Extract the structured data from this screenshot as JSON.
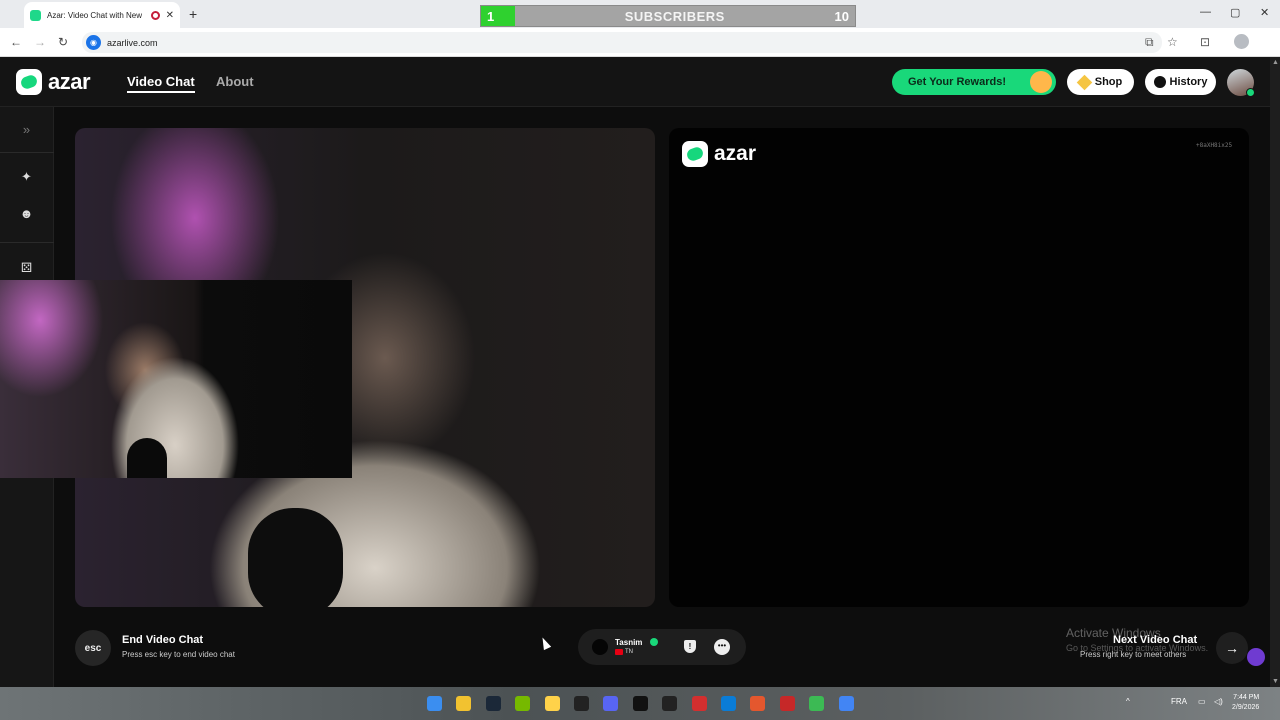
{
  "browser": {
    "tab_title": "Azar: Video Chat with New",
    "close_tab": "✕",
    "new_tab": "+",
    "url": "azarlive.com",
    "window_controls": [
      "—",
      "▢",
      "✕"
    ],
    "nav": [
      "←",
      "→",
      "↻"
    ],
    "right_icons": [
      "cast-icon",
      "star-icon",
      "extensions-icon"
    ]
  },
  "overlay": {
    "left_count": "1",
    "label": "SUBSCRIBERS",
    "right_count": "10"
  },
  "header": {
    "brand": "azar",
    "nav": [
      {
        "label": "Video Chat",
        "active": true
      },
      {
        "label": "About",
        "active": false
      }
    ],
    "rewards_label": "Get Your Rewards!",
    "shop_label": "Shop",
    "history_label": "History"
  },
  "rail": {
    "icons": [
      "double-chevron-right-icon",
      "magic-wand-icon",
      "smiley-icon",
      "dice-icon"
    ],
    "expand_glyph": "»"
  },
  "remote": {
    "brand": "azar",
    "session_id": "+8aXH8ix25"
  },
  "controls": {
    "esc_label": "esc",
    "end_title": "End Video Chat",
    "end_sub": "Press esc key to end video chat",
    "peer_name": "Tasnim",
    "peer_country": "TN",
    "report_glyph": "!",
    "chat_glyph": "•••",
    "next_title": "Next Video Chat",
    "next_sub": "Press right key to meet others",
    "next_glyph": "→"
  },
  "watermark": {
    "line1": "Activate Windows",
    "line2": "Go to Settings to activate Windows."
  },
  "taskbar": {
    "language": "FRA",
    "time": "7:44 PM",
    "date": "2/9/2026",
    "tray_chevron": "^",
    "app_colors": [
      "#3b8ef0",
      "#f2c230",
      "#1b2838",
      "#76b900",
      "#ffd24a",
      "#222222",
      "#5865f2",
      "#111111",
      "#222222",
      "#d32f2f",
      "#0a7cd6",
      "#e4572e",
      "#c62828",
      "#3cba54",
      "#4285f4"
    ]
  },
  "colors": {
    "accent": "#19d87a",
    "background": "#0d0d0d"
  }
}
